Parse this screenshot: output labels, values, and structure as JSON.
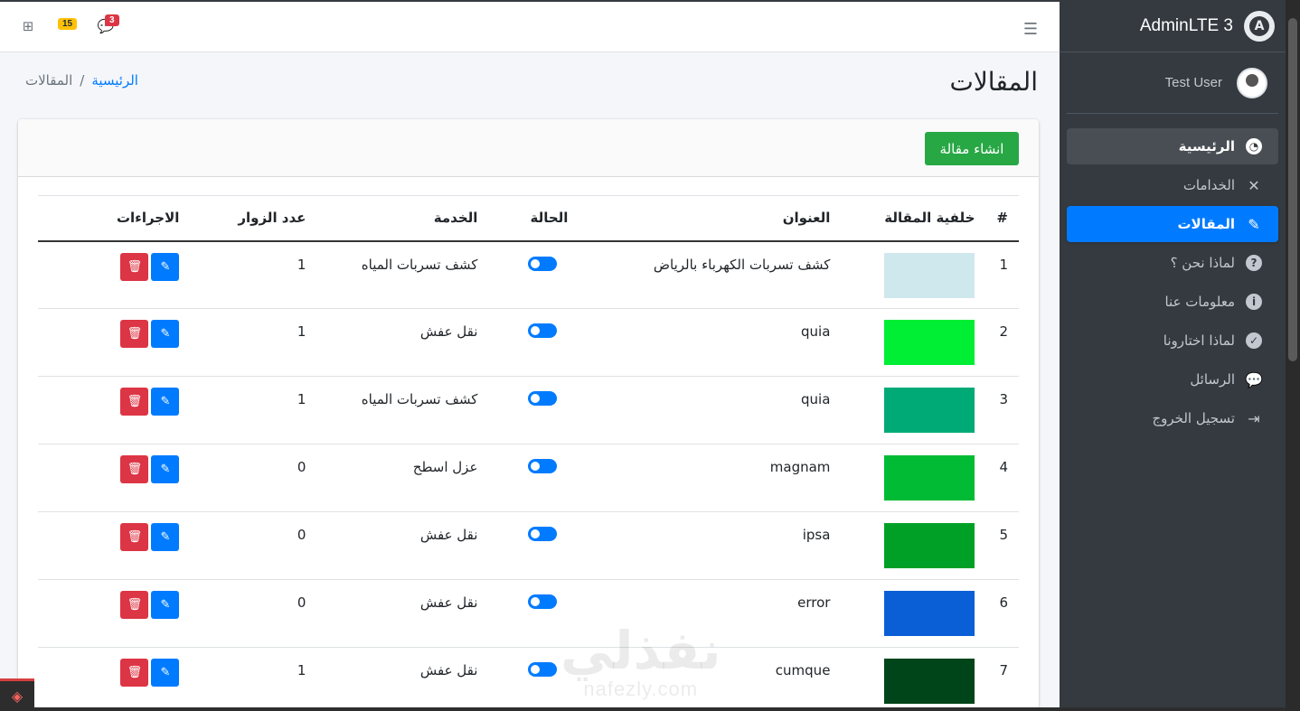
{
  "brand": {
    "name": "AdminLTE 3",
    "logo_letter": "A"
  },
  "user": {
    "name": "Test User"
  },
  "sidebar": {
    "items": [
      {
        "label": "الرئيسية",
        "icon": "tachometer-icon",
        "glyph": "◔",
        "state": "open"
      },
      {
        "label": "الخدامات",
        "icon": "tools-icon",
        "glyph": "✕",
        "state": ""
      },
      {
        "label": "المقالات",
        "icon": "pencil-icon",
        "glyph": "✎",
        "state": "active"
      },
      {
        "label": "لماذا نحن ؟",
        "icon": "question-circle-icon",
        "glyph": "?",
        "state": ""
      },
      {
        "label": "معلومات عنا",
        "icon": "info-circle-icon",
        "glyph": "i",
        "state": ""
      },
      {
        "label": "لماذا اختارونا",
        "icon": "check-circle-icon",
        "glyph": "✓",
        "state": ""
      },
      {
        "label": "الرسائل",
        "icon": "comments-icon",
        "glyph": "💬",
        "state": ""
      },
      {
        "label": "تسجيل الخروج",
        "icon": "sign-out-icon",
        "glyph": "⇥",
        "state": ""
      }
    ]
  },
  "topbar": {
    "notifications_count": "15",
    "messages_count": "3"
  },
  "page": {
    "title": "المقالات",
    "breadcrumb_home": "الرئيسية",
    "breadcrumb_separator": "/",
    "breadcrumb_current": "المقالات"
  },
  "toolbar": {
    "create_label": "انشاء مقالة"
  },
  "table": {
    "headers": {
      "num": "#",
      "background": "خلفية المقالة",
      "title": "العنوان",
      "status": "الحالة",
      "service": "الخدمة",
      "visitors": "عدد الزوار",
      "actions": "الاجراءات"
    },
    "rows": [
      {
        "num": "1",
        "title": "كشف تسربات الكهرباء بالرياض",
        "service": "كشف تسربات المياه",
        "visitors": "1",
        "thumb_color": "#cfe8ee",
        "thumb_text": ""
      },
      {
        "num": "2",
        "title": "quia",
        "service": "نقل عفش",
        "visitors": "1",
        "thumb_color": "#00ee33",
        "thumb_text": ""
      },
      {
        "num": "3",
        "title": "quia",
        "service": "كشف تسربات المياه",
        "visitors": "1",
        "thumb_color": "#00aa77",
        "thumb_text": ""
      },
      {
        "num": "4",
        "title": "magnam",
        "service": "عزل اسطح",
        "visitors": "0",
        "thumb_color": "#00bb33",
        "thumb_text": ""
      },
      {
        "num": "5",
        "title": "ipsa",
        "service": "نقل عفش",
        "visitors": "0",
        "thumb_color": "#00a027",
        "thumb_text": ""
      },
      {
        "num": "6",
        "title": "error",
        "service": "نقل عفش",
        "visitors": "0",
        "thumb_color": "#0a5fd6",
        "thumb_text": ""
      },
      {
        "num": "7",
        "title": "cumque",
        "service": "نقل عفش",
        "visitors": "1",
        "thumb_color": "#00441a",
        "thumb_text": ""
      }
    ]
  },
  "watermark": {
    "arabic": "نفذلي",
    "latin": "nafezly.com"
  }
}
